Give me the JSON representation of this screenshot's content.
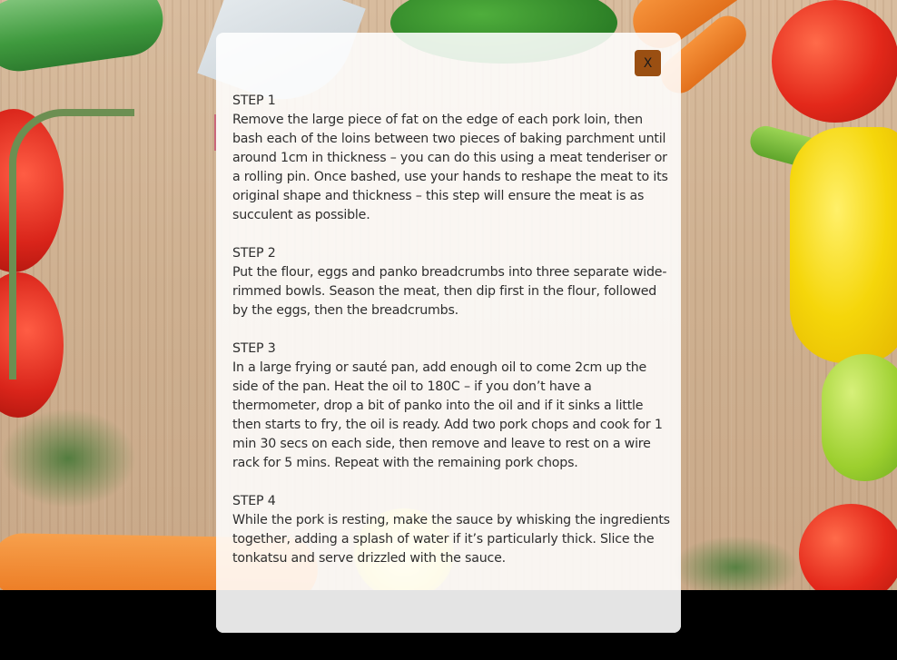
{
  "modal": {
    "close_label": "X",
    "steps": [
      {
        "title": "STEP 1",
        "text": "Remove the large piece of fat on the edge of each pork loin, then bash each of the loins between two pieces of baking parchment until around 1cm in thickness – you can do this using a meat tenderiser or a rolling pin. Once bashed, use your hands to reshape the meat to its original shape and thickness – this step will ensure the meat is as succulent as possible."
      },
      {
        "title": "STEP 2",
        "text": "Put the flour, eggs and panko breadcrumbs into three separate wide-rimmed bowls. Season the meat, then dip first in the flour, followed by the eggs, then the breadcrumbs."
      },
      {
        "title": "STEP 3",
        "text": "In a large frying or sauté pan, add enough oil to come 2cm up the side of the pan. Heat the oil to 180C – if you don’t have a thermometer, drop a bit of panko into the oil and if it sinks a little then starts to fry, the oil is ready. Add two pork chops and cook for 1 min 30 secs on each side, then remove and leave to rest on a wire rack for 5 mins. Repeat with the remaining pork chops."
      },
      {
        "title": "STEP 4",
        "text": "While the pork is resting, make the sauce by whisking the ingredients together, adding a splash of water if it’s particularly thick. Slice the tonkatsu and serve drizzled with the sauce."
      }
    ]
  },
  "colors": {
    "close_button": "#9a4f12",
    "modal_background": "#ffffff",
    "footer_background": "#e4e4e4",
    "text": "#2e2e2e"
  }
}
